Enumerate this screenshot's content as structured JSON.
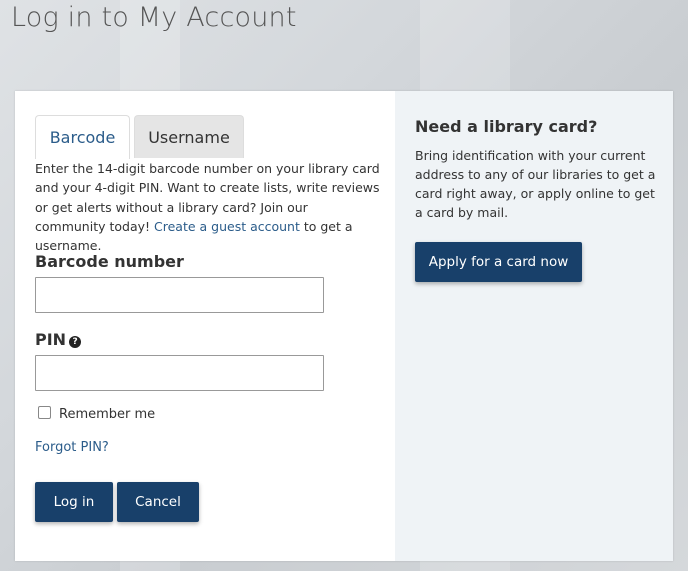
{
  "page": {
    "title": "Log in to My Account"
  },
  "tabs": [
    {
      "label": "Barcode",
      "active": true
    },
    {
      "label": "Username",
      "active": false
    }
  ],
  "intro": {
    "text_before": "Enter the 14-digit barcode number on your library card and your 4-digit PIN. Want to create lists, write reviews or get alerts without a library card? Join our community today! ",
    "link": "Create a guest account",
    "text_after": " to get a username."
  },
  "form": {
    "barcode_label": "Barcode number",
    "barcode_value": "",
    "pin_label": "PIN",
    "pin_help_icon": "question-circle-icon",
    "pin_value": "",
    "remember_label": "Remember me",
    "remember_checked": false,
    "forgot_label": "Forgot PIN?",
    "login_label": "Log in",
    "cancel_label": "Cancel"
  },
  "sidebar": {
    "title": "Need a library card?",
    "text": "Bring identification with your current address to any of our libraries to get a card right away, or apply online to get a card by mail.",
    "apply_label": "Apply for a card now"
  },
  "colors": {
    "primary_button": "#18406a",
    "link": "#2b5c8a",
    "sidebar_bg": "#eff3f6"
  }
}
